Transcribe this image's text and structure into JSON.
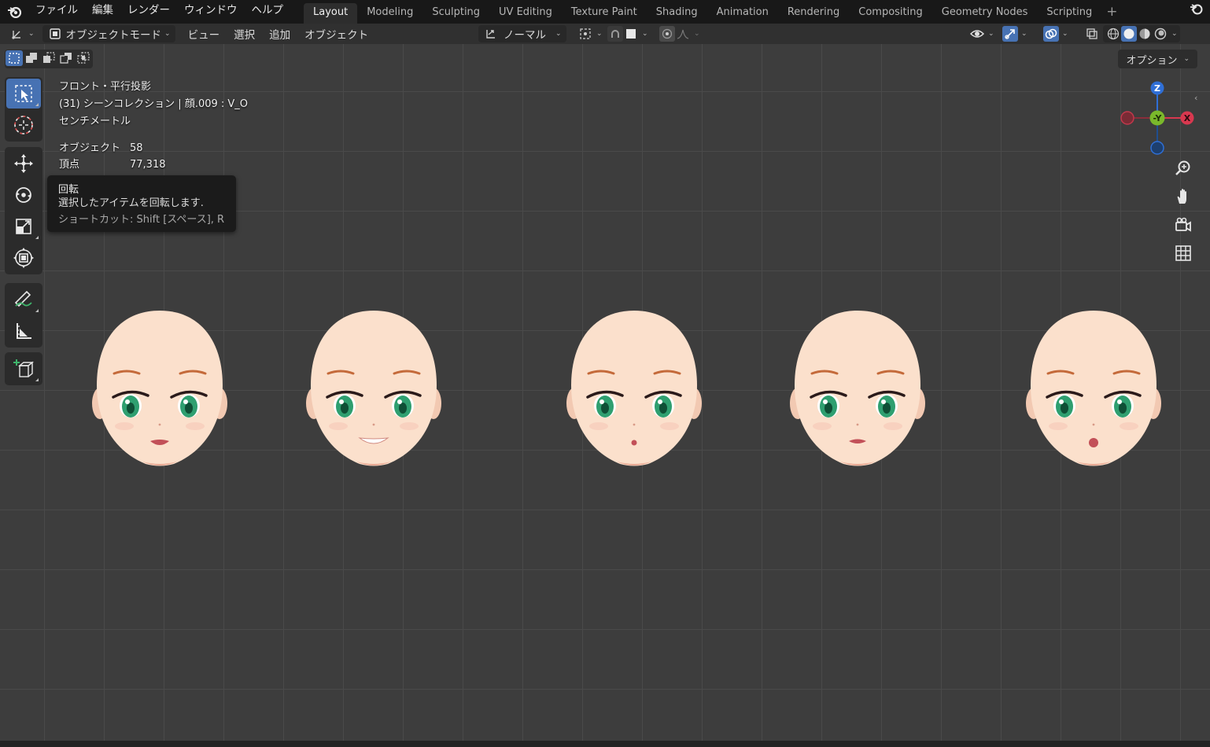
{
  "menubar": {
    "items": [
      "ファイル",
      "編集",
      "レンダー",
      "ウィンドウ",
      "ヘルプ"
    ],
    "tabs": [
      "Layout",
      "Modeling",
      "Sculpting",
      "UV Editing",
      "Texture Paint",
      "Shading",
      "Animation",
      "Rendering",
      "Compositing",
      "Geometry Nodes",
      "Scripting"
    ],
    "active_tab": "Layout"
  },
  "header": {
    "mode": "オブジェクトモード",
    "menus": [
      "ビュー",
      "選択",
      "追加",
      "オブジェクト"
    ],
    "transform_orientation": "ノーマル",
    "options": "オプション"
  },
  "viewport_info": {
    "view": "フロント・平行投影",
    "collection": "(31) シーンコレクション | 顔.009 : V_O",
    "units": "センチメートル",
    "objects_label": "オブジェクト",
    "objects_value": "58",
    "vertices_label": "頂点",
    "vertices_value": "77,318"
  },
  "tooltip": {
    "title": "回転",
    "description": "選択したアイテムを回転します.",
    "shortcut": "ショートカット: Shift [スペース], R"
  },
  "gizmo": {
    "z": "Z",
    "y": "-Y",
    "x": "X"
  },
  "faces": [
    {
      "mouth": "open"
    },
    {
      "mouth": "smile"
    },
    {
      "mouth": "small"
    },
    {
      "mouth": "e"
    },
    {
      "mouth": "o"
    }
  ],
  "colors": {
    "accent": "#4772b3",
    "skin": "#fbe0cc",
    "eye": "#2f9f70",
    "brow": "#c46a3a"
  }
}
